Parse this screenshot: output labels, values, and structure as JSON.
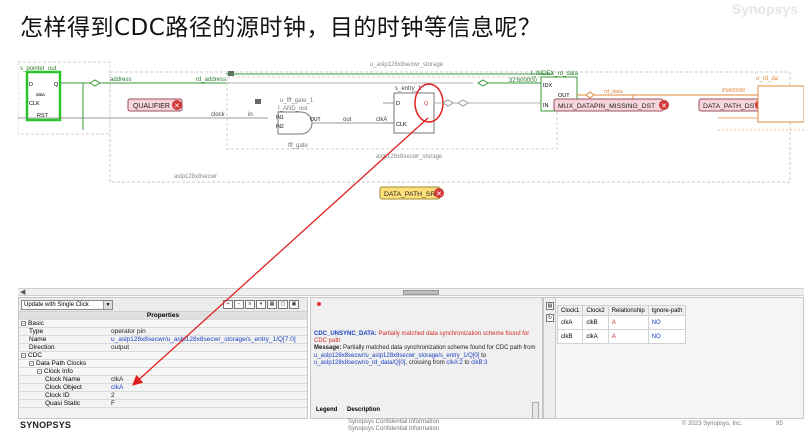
{
  "slide": {
    "title": "怎样得到CDC路径的源时钟，目的时钟等信息呢？",
    "logo_faint": "Synopsys"
  },
  "schematic": {
    "labels": {
      "top_storage": "u_aslp128x8secwr_storage",
      "s_pointer_out": "s_pointer_out",
      "d_pin": "D",
      "q_pin": "Q",
      "clk_pin": "CLK",
      "rst_pin": "RST",
      "data_pin": "data",
      "address": "address",
      "rd_address": "rd_address",
      "qualifier": "QUALIFIER",
      "clock_net": "clock",
      "in_net": "in",
      "fff_gate_1": "u_fff_gate_1",
      "i_and_out": "I_AND_out",
      "and_in1": "IN1",
      "and_in2": "IN2",
      "and_out": "OUT",
      "out_net": "out",
      "clka_net": "clkA",
      "fff_gate": "fff_gate",
      "s_entry_1": "s_entry_1",
      "s_d": "D",
      "s_q": "Q",
      "s_clk": "CLK",
      "bottom_storage": "aslp128x8secwr_storage",
      "left_storage": "aslp128x8secwr",
      "i_index": "I_INDEX_rd_data",
      "const_val": "32'b00000",
      "idx": "IDX",
      "out_pin": "OUT",
      "in_pin": "IN",
      "rd_data_net": "rd_data",
      "mux_dst": "MUX_DATAPIN_MISSING_DST",
      "data_path_dst": "DATA_PATH_DST",
      "right_const": "8'b000000",
      "o_rd_data": "o_rd_da",
      "data_path_src": "DATA_PATH_SRC"
    }
  },
  "properties": {
    "mode_select": "Update with Single Click",
    "header": "Properties",
    "rows": [
      {
        "level": 0,
        "key": "Basic",
        "value": "",
        "group": true
      },
      {
        "level": 1,
        "key": "Type",
        "value": "operator pin",
        "link": false
      },
      {
        "level": 1,
        "key": "Name",
        "value": "u_aslp128x8secwr/u_aslp128x8secwr_storage/s_entry_1/Q[7:0]",
        "link": true
      },
      {
        "level": 1,
        "key": "Direction",
        "value": "output",
        "link": false
      },
      {
        "level": 0,
        "key": "CDC",
        "value": "",
        "group": true
      },
      {
        "level": 1,
        "key": "Data Path Clocks",
        "value": "",
        "group": true
      },
      {
        "level": 2,
        "key": "Clock Info",
        "value": "",
        "group": true
      },
      {
        "level": 3,
        "key": "Clock Name",
        "value": "clkA",
        "link": false
      },
      {
        "level": 3,
        "key": "Clock Object",
        "value": "clkA",
        "link": true
      },
      {
        "level": 3,
        "key": "Clock ID",
        "value": "2",
        "link": false
      },
      {
        "level": 3,
        "key": "Quasi Static",
        "value": "F",
        "link": false
      }
    ]
  },
  "message": {
    "tag": "CDC_UNSYNC_DATA:",
    "tag_text": "Partially matched data synchronization scheme found for CDC path",
    "label": "Message:",
    "text_1": "Partially matched data synchronization scheme found for CDC path from",
    "src_path": "u_aslp128x8secwr/u_aslp128x8secwr_storage/s_entry_1/Q[0]",
    "text_to": "to",
    "dst_path": "u_aslp128x8secwr/o_rd_data/Q[0]",
    "text_crossing": ", crossing from",
    "from_clk": "clkA:2",
    "text_to2": "to",
    "to_clk": "clkB:3",
    "legend_col1": "Legend",
    "legend_col2": "Description"
  },
  "clock_table": {
    "headers": [
      "Clock1",
      "Clock2",
      "Relationship",
      "Ignore-path"
    ],
    "rows": [
      [
        "clkA",
        "clkB",
        "A",
        "NO"
      ],
      [
        "clkB",
        "clkA",
        "A",
        "NO"
      ]
    ]
  },
  "footer": {
    "logo": "SYNOPSYS",
    "confidential_1": "Synopsys Confidential Information",
    "confidential_2": "Synopsys Confidential Information",
    "copyright": "© 2023 Synopsys, Inc.",
    "page": "95"
  },
  "colors": {
    "green_ff": "#2bc52b",
    "wire_green": "#3a9a3a",
    "wire_orange": "#e0883a",
    "box_pink": "#f6d6dc",
    "box_yellow": "#fde07a",
    "badge_red": "#d23a3a",
    "arrow_red": "#e02020"
  }
}
